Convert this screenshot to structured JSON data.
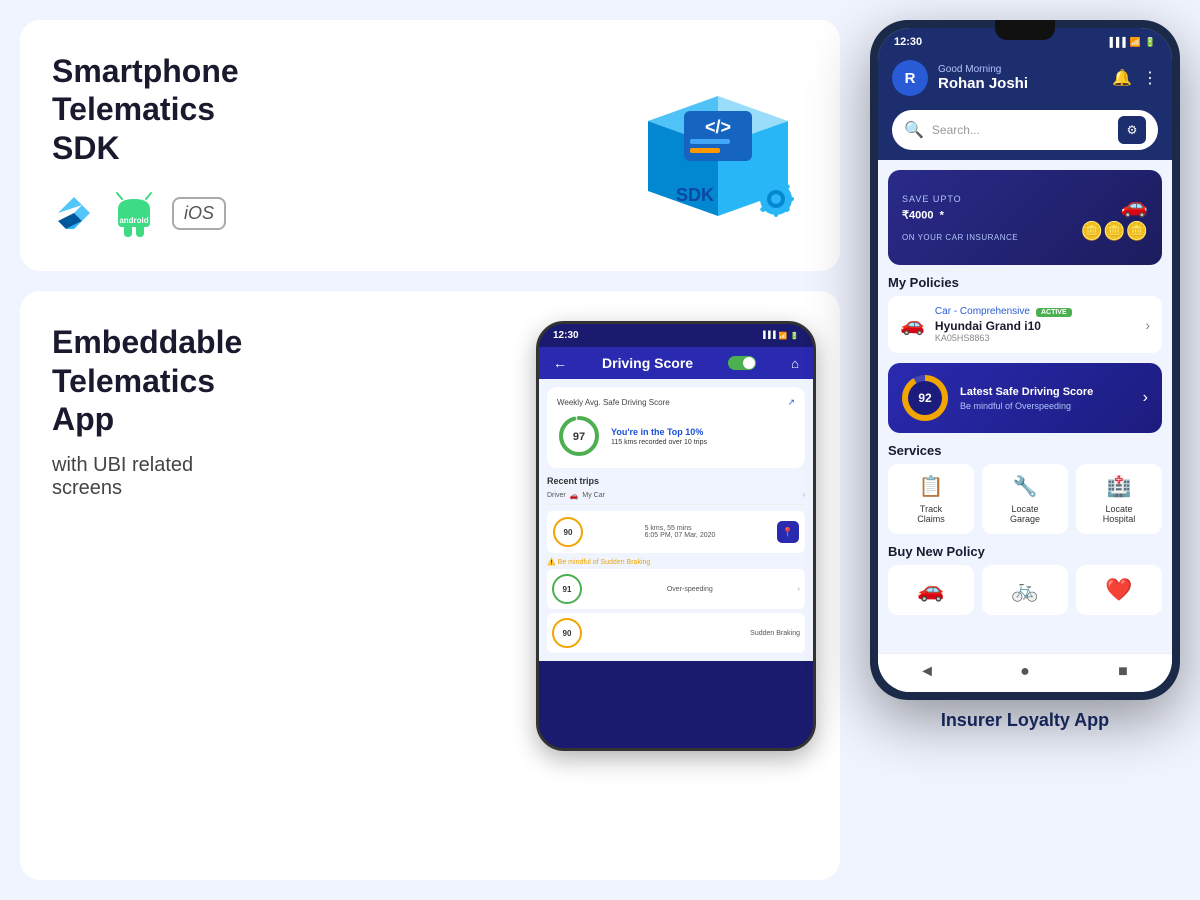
{
  "page": {
    "background": "#f0f4ff"
  },
  "sdk_card": {
    "title": "Smartphone\nTelematics\nSDK",
    "logos": [
      "flutter",
      "android",
      "iOS"
    ]
  },
  "telematics_card": {
    "title": "Embeddable\nTelematics\nApp",
    "subtitle": "with UBI related screens"
  },
  "mini_phone": {
    "time": "12:30",
    "header_title": "Driving Score",
    "score_label": "Weekly Avg. Safe Driving Score",
    "score": "97",
    "score_top": "You're in the Top 10%",
    "score_trips": "115 kms recorded over 10 trips",
    "recent_trips": "Recent trips",
    "tab1": "Driver",
    "tab2": "My Car",
    "trip1_score": "90",
    "trip1_dist": "5 kms, 55 mins",
    "trip1_time": "6:05 PM, 07 Mar, 2020",
    "trip1_warning": "Be mindful of Sudden Braking",
    "trip2_label": "Over-speeding",
    "trip2_score": "91",
    "trip3_label": "Sudden Braking",
    "trip3_score": "90"
  },
  "phone": {
    "time": "12:30",
    "greeting_small": "Good Morning",
    "greeting_name": "Rohan Joshi",
    "avatar_letter": "R",
    "search_placeholder": "Search...",
    "banner": {
      "save_label": "SAVE UPTO",
      "amount": "₹4000",
      "amount_asterisk": "*",
      "subtitle": "ON YOUR CAR INSURANCE"
    },
    "my_policies_label": "My Policies",
    "policy": {
      "type": "Car - Comprehensive",
      "status": "ACTIVE",
      "model": "Hyundai Grand i10",
      "plate": "KA05HS8863"
    },
    "driving_score": {
      "score": "92",
      "title": "Latest Safe Driving Score",
      "subtitle": "Be mindful of Overspeeding"
    },
    "services_label": "Services",
    "services": [
      {
        "label": "Track\nClaims",
        "icon": "📋"
      },
      {
        "label": "Locate\nGarage",
        "icon": "🔧"
      },
      {
        "label": "Locate\nHospital",
        "icon": "🏥"
      }
    ],
    "buy_policy_label": "Buy New Policy",
    "buy_policies": [
      {
        "label": "Car",
        "icon": "🚗"
      },
      {
        "label": "Bike",
        "icon": "🚲"
      },
      {
        "label": "Health",
        "icon": "❤️"
      }
    ]
  },
  "insurer_label": "Insurer Loyalty App"
}
